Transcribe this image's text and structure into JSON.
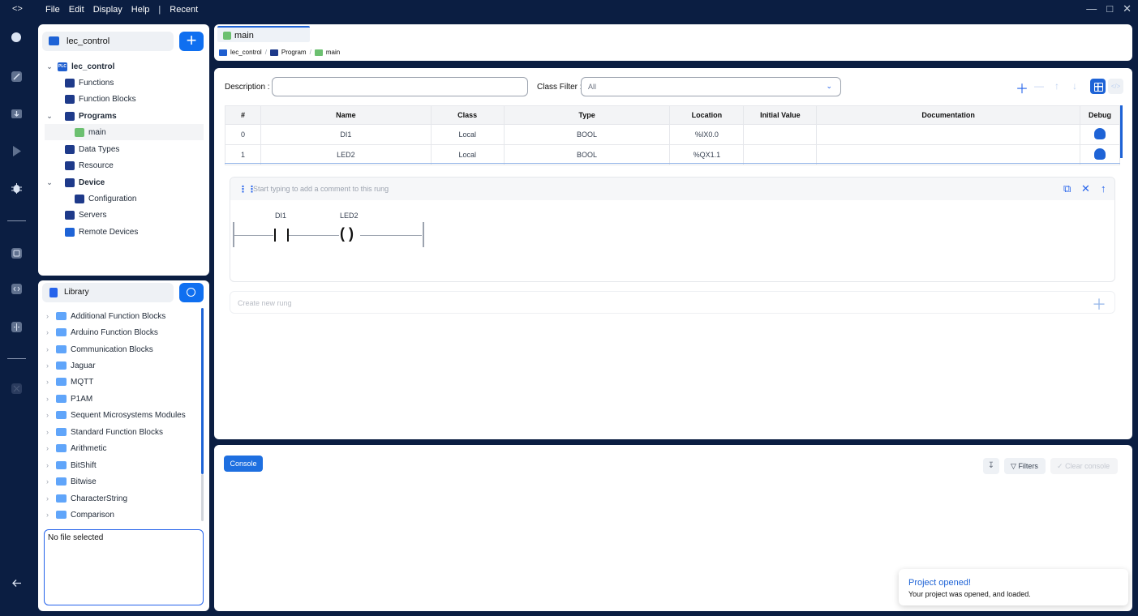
{
  "titlebar": {
    "code_icon": "<>",
    "menu": [
      "File",
      "Edit",
      "Display",
      "Help",
      "|",
      "Recent"
    ],
    "window_controls": [
      "minimize-icon",
      "maximize-icon",
      "close-icon"
    ]
  },
  "activity_bar": {
    "icons": [
      "search-icon",
      "zoom-icon",
      "download-icon",
      "play-icon",
      "debug-icon",
      "box-icon",
      "code-toggle-icon",
      "split-icon",
      "close-icon",
      "back-arrow-icon"
    ]
  },
  "project": {
    "title": "lec_control",
    "add_label": "+",
    "tree": [
      {
        "label": "lec_control",
        "level": 0,
        "expanded": true,
        "badge": "PLC"
      },
      {
        "label": "Functions",
        "level": 1
      },
      {
        "label": "Function Blocks",
        "level": 1
      },
      {
        "label": "Programs",
        "level": 1,
        "expanded": true
      },
      {
        "label": "main",
        "level": 2,
        "selected": true
      },
      {
        "label": "Data Types",
        "level": 1
      },
      {
        "label": "Resource",
        "level": 1
      },
      {
        "label": "Device",
        "level": 1,
        "expanded": true
      },
      {
        "label": "Configuration",
        "level": 2
      },
      {
        "label": "Servers",
        "level": 1
      },
      {
        "label": "Remote Devices",
        "level": 1
      }
    ]
  },
  "library": {
    "title": "Library",
    "items": [
      "Additional Function Blocks",
      "Arduino Function Blocks",
      "Communication Blocks",
      "Jaguar",
      "MQTT",
      "P1AM",
      "Sequent Microsystems Modules",
      "Standard Function Blocks",
      "Arithmetic",
      "BitShift",
      "Bitwise",
      "CharacterString",
      "Comparison"
    ],
    "preview_text": "No file selected"
  },
  "editor_tab": {
    "label": "main",
    "breadcrumb": [
      "lec_control",
      "Program",
      "main"
    ]
  },
  "filters": {
    "description_label": "Description :",
    "description_value": "",
    "class_filter_label": "Class Filter :",
    "class_filter_value": "All"
  },
  "variables": {
    "columns": [
      "#",
      "Name",
      "Class",
      "Type",
      "Location",
      "Initial Value",
      "Documentation",
      "Debug"
    ],
    "rows": [
      [
        "0",
        "DI1",
        "Local",
        "BOOL",
        "%IX0.0",
        "",
        ""
      ],
      [
        "1",
        "LED2",
        "Local",
        "BOOL",
        "%QX1.1",
        "",
        ""
      ]
    ]
  },
  "rung": {
    "comment_placeholder": "Start typing to add a comment to this rung",
    "contact_label": "DI1",
    "coil_label": "LED2",
    "coil_symbol": "( )"
  },
  "new_rung": {
    "placeholder": "Create new rung"
  },
  "console": {
    "tab_label": "Console",
    "filters_label": "Filters",
    "clear_label": "Clear console"
  },
  "toast": {
    "title": "Project opened!",
    "body": "Your project was opened, and loaded."
  },
  "colors": {
    "sidebar_bg": "#0b1e42",
    "accent": "#1e63d6",
    "panel_bg": "#ffffff"
  }
}
